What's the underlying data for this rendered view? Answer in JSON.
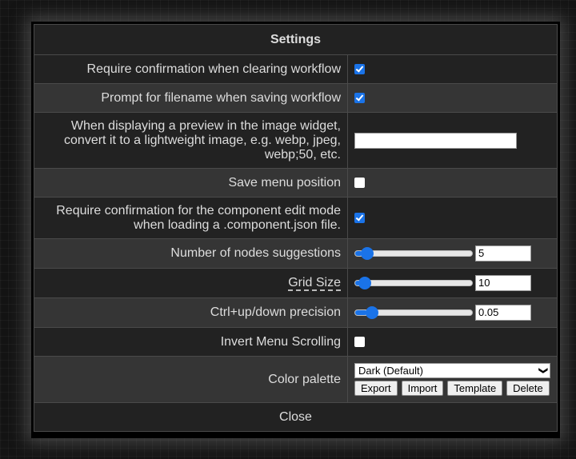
{
  "dialog": {
    "title": "Settings",
    "close_label": "Close"
  },
  "settings": [
    {
      "label": "Require confirmation when clearing workflow",
      "type": "checkbox",
      "checked": true
    },
    {
      "label": "Prompt for filename when saving workflow",
      "type": "checkbox",
      "checked": true
    },
    {
      "label": "When displaying a preview in the image widget, convert it to a lightweight image, e.g. webp, jpeg, webp;50, etc.",
      "type": "text",
      "value": ""
    },
    {
      "label": "Save menu position",
      "type": "checkbox",
      "checked": false
    },
    {
      "label": "Require confirmation for the component edit mode when loading a .component.json file.",
      "type": "checkbox",
      "checked": true
    },
    {
      "label": "Number of nodes suggestions",
      "type": "slider",
      "value": "5",
      "fraction": 0.06
    },
    {
      "label": "Grid Size",
      "type": "slider",
      "value": "10",
      "fraction": 0.04
    },
    {
      "label": "Ctrl+up/down precision",
      "type": "slider",
      "value": "0.05",
      "fraction": 0.1
    },
    {
      "label": "Invert Menu Scrolling",
      "type": "checkbox",
      "checked": false
    },
    {
      "label": "Color palette",
      "type": "select",
      "value": "Dark (Default)",
      "buttons": [
        "Export",
        "Import",
        "Template",
        "Delete"
      ]
    }
  ],
  "colors": {
    "accent": "#1a73e8",
    "panel": "#222222",
    "panel_alt": "#353535"
  }
}
